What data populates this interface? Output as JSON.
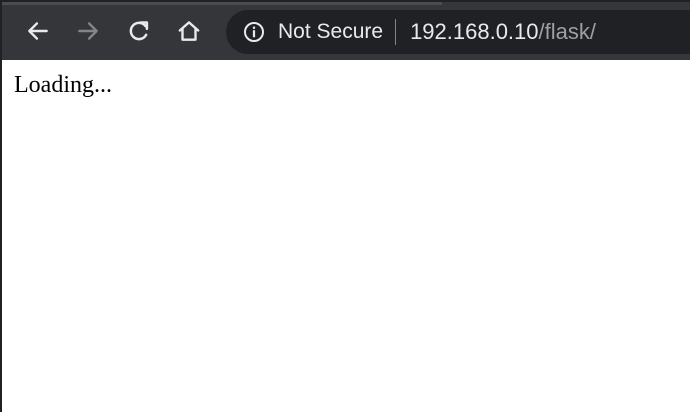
{
  "browser": {
    "toolbar": {
      "back_icon": "arrow-left-icon",
      "forward_icon": "arrow-right-icon",
      "reload_icon": "reload-icon",
      "home_icon": "home-icon",
      "forward_enabled": false
    },
    "omnibox": {
      "security_icon": "info-circle-icon",
      "security_label": "Not Secure",
      "url_host": "192.168.0.10",
      "url_path": "/flask/"
    },
    "colors": {
      "toolbar_bg": "#35363a",
      "omnibox_bg": "#202124",
      "icon_active": "#e8eaed",
      "icon_disabled": "#80868b",
      "url_path": "#9aa0a6"
    }
  },
  "page": {
    "body_text": "Loading..."
  }
}
